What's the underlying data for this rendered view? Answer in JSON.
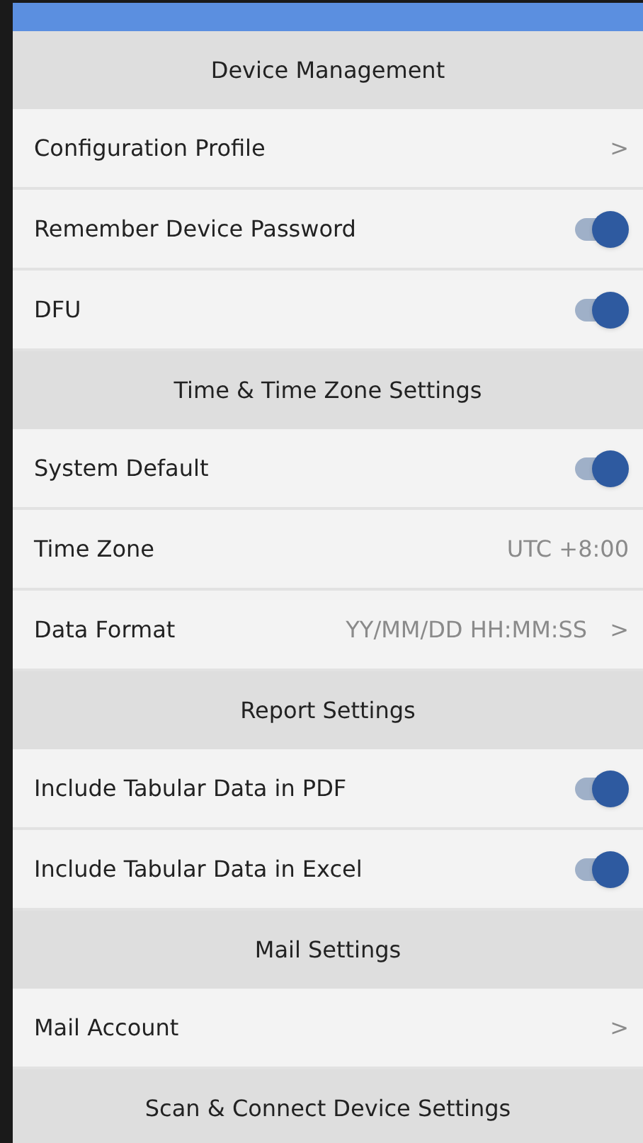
{
  "sections": [
    {
      "title": "Device Management",
      "items": [
        {
          "kind": "link",
          "label": "Configuration Profile",
          "chevron": ">"
        },
        {
          "kind": "toggle",
          "label": "Remember Device Password",
          "on": true
        },
        {
          "kind": "toggle",
          "label": "DFU",
          "on": true
        }
      ]
    },
    {
      "title": "Time & Time Zone Settings",
      "items": [
        {
          "kind": "toggle",
          "label": "System Default",
          "on": true
        },
        {
          "kind": "value",
          "label": "Time Zone",
          "value": "UTC +8:00"
        },
        {
          "kind": "link",
          "label": "Data Format",
          "value": "YY/MM/DD HH:MM:SS",
          "chevron": ">"
        }
      ]
    },
    {
      "title": "Report Settings",
      "items": [
        {
          "kind": "toggle",
          "label": "Include Tabular Data in PDF",
          "on": true
        },
        {
          "kind": "toggle",
          "label": "Include Tabular Data in Excel",
          "on": true
        }
      ]
    },
    {
      "title": "Mail Settings",
      "items": [
        {
          "kind": "link",
          "label": "Mail Account",
          "chevron": ">"
        }
      ]
    },
    {
      "title": "Scan & Connect Device Settings"
    }
  ]
}
